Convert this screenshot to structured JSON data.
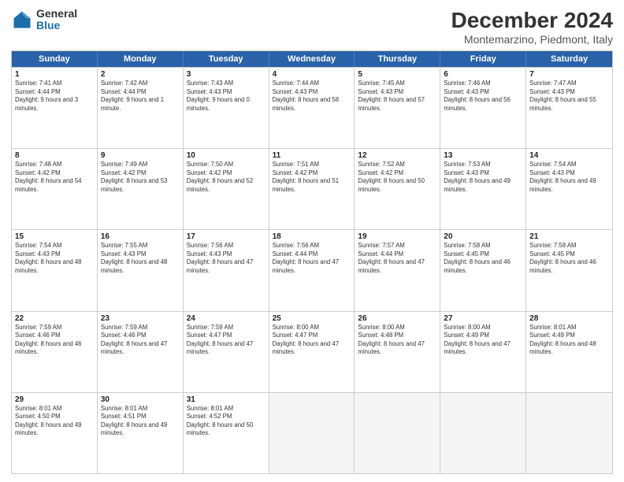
{
  "logo": {
    "general": "General",
    "blue": "Blue"
  },
  "title": "December 2024",
  "subtitle": "Montemarzino, Piedmont, Italy",
  "days_of_week": [
    "Sunday",
    "Monday",
    "Tuesday",
    "Wednesday",
    "Thursday",
    "Friday",
    "Saturday"
  ],
  "weeks": [
    [
      {
        "day": 1,
        "sunrise": "7:41 AM",
        "sunset": "4:44 PM",
        "daylight": "9 hours and 3 minutes."
      },
      {
        "day": 2,
        "sunrise": "7:42 AM",
        "sunset": "4:44 PM",
        "daylight": "9 hours and 1 minute."
      },
      {
        "day": 3,
        "sunrise": "7:43 AM",
        "sunset": "4:43 PM",
        "daylight": "9 hours and 0 minutes."
      },
      {
        "day": 4,
        "sunrise": "7:44 AM",
        "sunset": "4:43 PM",
        "daylight": "8 hours and 58 minutes."
      },
      {
        "day": 5,
        "sunrise": "7:45 AM",
        "sunset": "4:43 PM",
        "daylight": "8 hours and 57 minutes."
      },
      {
        "day": 6,
        "sunrise": "7:46 AM",
        "sunset": "4:43 PM",
        "daylight": "8 hours and 56 minutes."
      },
      {
        "day": 7,
        "sunrise": "7:47 AM",
        "sunset": "4:43 PM",
        "daylight": "8 hours and 55 minutes."
      }
    ],
    [
      {
        "day": 8,
        "sunrise": "7:48 AM",
        "sunset": "4:42 PM",
        "daylight": "8 hours and 54 minutes."
      },
      {
        "day": 9,
        "sunrise": "7:49 AM",
        "sunset": "4:42 PM",
        "daylight": "8 hours and 53 minutes."
      },
      {
        "day": 10,
        "sunrise": "7:50 AM",
        "sunset": "4:42 PM",
        "daylight": "8 hours and 52 minutes."
      },
      {
        "day": 11,
        "sunrise": "7:51 AM",
        "sunset": "4:42 PM",
        "daylight": "8 hours and 51 minutes."
      },
      {
        "day": 12,
        "sunrise": "7:52 AM",
        "sunset": "4:42 PM",
        "daylight": "8 hours and 50 minutes."
      },
      {
        "day": 13,
        "sunrise": "7:53 AM",
        "sunset": "4:43 PM",
        "daylight": "8 hours and 49 minutes."
      },
      {
        "day": 14,
        "sunrise": "7:54 AM",
        "sunset": "4:43 PM",
        "daylight": "8 hours and 49 minutes."
      }
    ],
    [
      {
        "day": 15,
        "sunrise": "7:54 AM",
        "sunset": "4:43 PM",
        "daylight": "8 hours and 48 minutes."
      },
      {
        "day": 16,
        "sunrise": "7:55 AM",
        "sunset": "4:43 PM",
        "daylight": "8 hours and 48 minutes."
      },
      {
        "day": 17,
        "sunrise": "7:56 AM",
        "sunset": "4:43 PM",
        "daylight": "8 hours and 47 minutes."
      },
      {
        "day": 18,
        "sunrise": "7:56 AM",
        "sunset": "4:44 PM",
        "daylight": "8 hours and 47 minutes."
      },
      {
        "day": 19,
        "sunrise": "7:57 AM",
        "sunset": "4:44 PM",
        "daylight": "8 hours and 47 minutes."
      },
      {
        "day": 20,
        "sunrise": "7:58 AM",
        "sunset": "4:45 PM",
        "daylight": "8 hours and 46 minutes."
      },
      {
        "day": 21,
        "sunrise": "7:58 AM",
        "sunset": "4:45 PM",
        "daylight": "8 hours and 46 minutes."
      }
    ],
    [
      {
        "day": 22,
        "sunrise": "7:59 AM",
        "sunset": "4:46 PM",
        "daylight": "8 hours and 46 minutes."
      },
      {
        "day": 23,
        "sunrise": "7:59 AM",
        "sunset": "4:46 PM",
        "daylight": "8 hours and 47 minutes."
      },
      {
        "day": 24,
        "sunrise": "7:59 AM",
        "sunset": "4:47 PM",
        "daylight": "8 hours and 47 minutes."
      },
      {
        "day": 25,
        "sunrise": "8:00 AM",
        "sunset": "4:47 PM",
        "daylight": "8 hours and 47 minutes."
      },
      {
        "day": 26,
        "sunrise": "8:00 AM",
        "sunset": "4:48 PM",
        "daylight": "8 hours and 47 minutes."
      },
      {
        "day": 27,
        "sunrise": "8:00 AM",
        "sunset": "4:49 PM",
        "daylight": "8 hours and 47 minutes."
      },
      {
        "day": 28,
        "sunrise": "8:01 AM",
        "sunset": "4:49 PM",
        "daylight": "8 hours and 48 minutes."
      }
    ],
    [
      {
        "day": 29,
        "sunrise": "8:01 AM",
        "sunset": "4:50 PM",
        "daylight": "8 hours and 49 minutes."
      },
      {
        "day": 30,
        "sunrise": "8:01 AM",
        "sunset": "4:51 PM",
        "daylight": "8 hours and 49 minutes."
      },
      {
        "day": 31,
        "sunrise": "8:01 AM",
        "sunset": "4:52 PM",
        "daylight": "8 hours and 50 minutes."
      },
      null,
      null,
      null,
      null
    ]
  ]
}
